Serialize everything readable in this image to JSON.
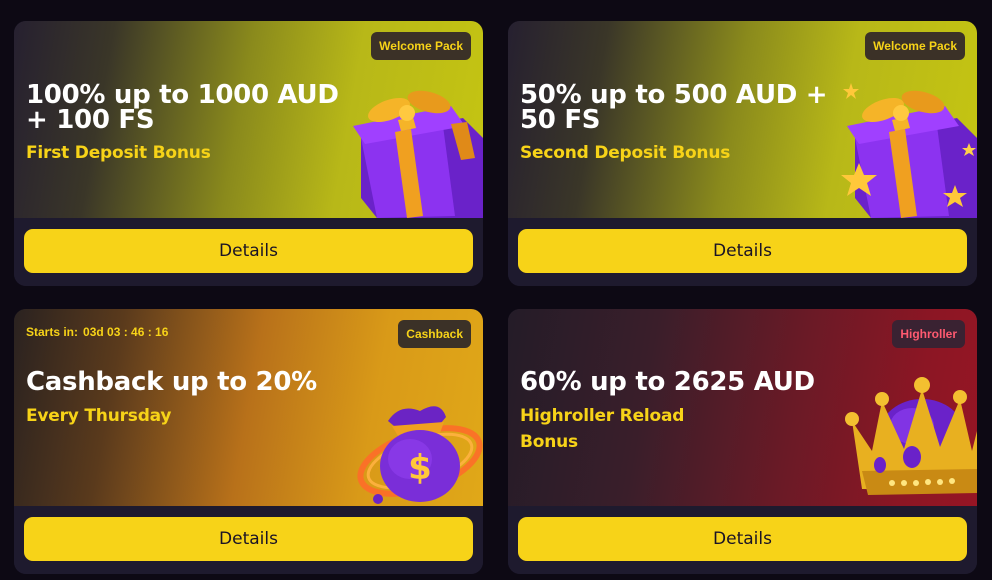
{
  "cards": [
    {
      "badge": "Welcome Pack",
      "title": "100% up to 1000 AUD + 100 FS",
      "subtitle": "First Deposit Bonus",
      "button": "Details"
    },
    {
      "badge": "Welcome Pack",
      "title": "50% up to 500 AUD + 50 FS",
      "subtitle": "Second Deposit Bonus",
      "button": "Details"
    },
    {
      "badge": "Cashback",
      "timer_label": "Starts in:",
      "timer_value": "03d 03 : 46 : 16",
      "title": "Cashback up to 20%",
      "subtitle": "Every Thursday",
      "button": "Details"
    },
    {
      "badge": "Highroller",
      "title": "60% up to 2625 AUD",
      "subtitle": "Highroller Reload Bonus",
      "button": "Details"
    }
  ],
  "colors": {
    "page_bg": "#0d0914",
    "card_footer": "#1e1a2e",
    "button_yellow": "#f7d318",
    "accent_yellow": "#f7d318",
    "highroller_red": "#ff5a70"
  },
  "icons": [
    "gift-box-icon",
    "gift-box-stars-icon",
    "money-bag-icon",
    "crown-icon"
  ]
}
